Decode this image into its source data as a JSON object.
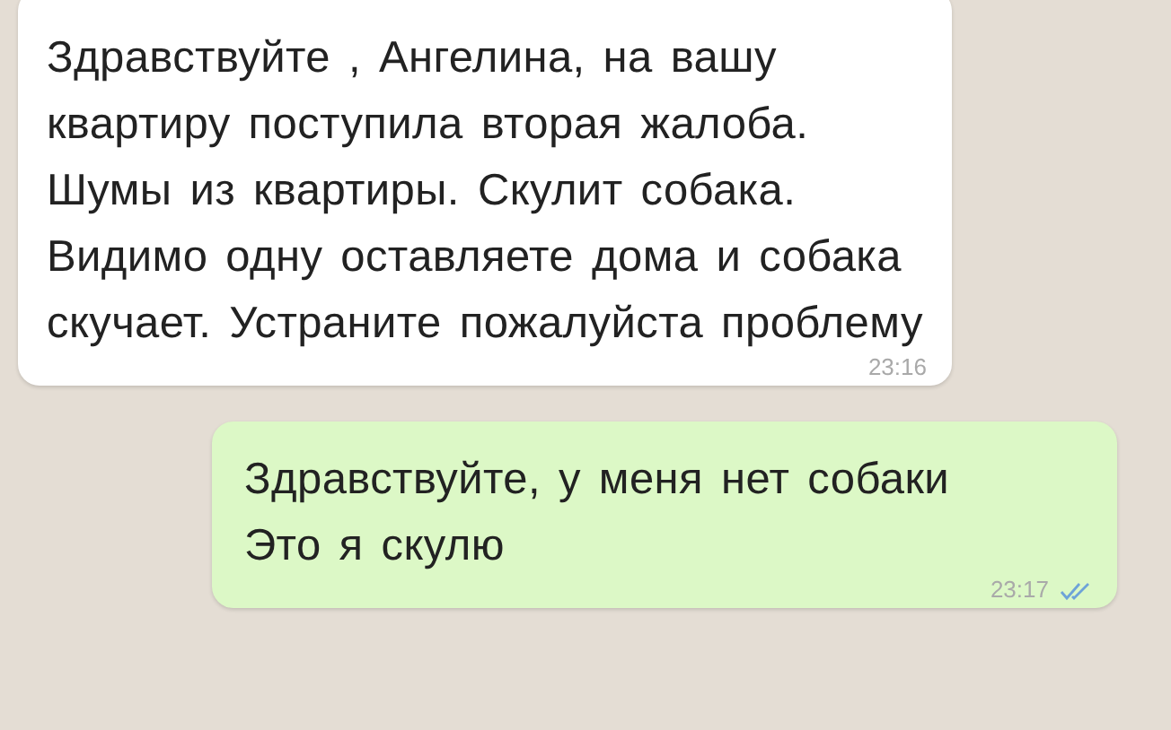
{
  "messages": [
    {
      "kind": "incoming",
      "text": "Здравствуйте , Ангелина, на вашу квартиру поступила вторая жалоба. Шумы из квартиры. Скулит собака. Видимо одну оставляете дома и собака скучает. Устраните пожалуйста проблему",
      "time": "23:16"
    },
    {
      "kind": "outgoing",
      "text": "Здравствуйте, у меня нет собаки\nЭто я скулю",
      "time": "23:17",
      "read": true
    }
  ]
}
